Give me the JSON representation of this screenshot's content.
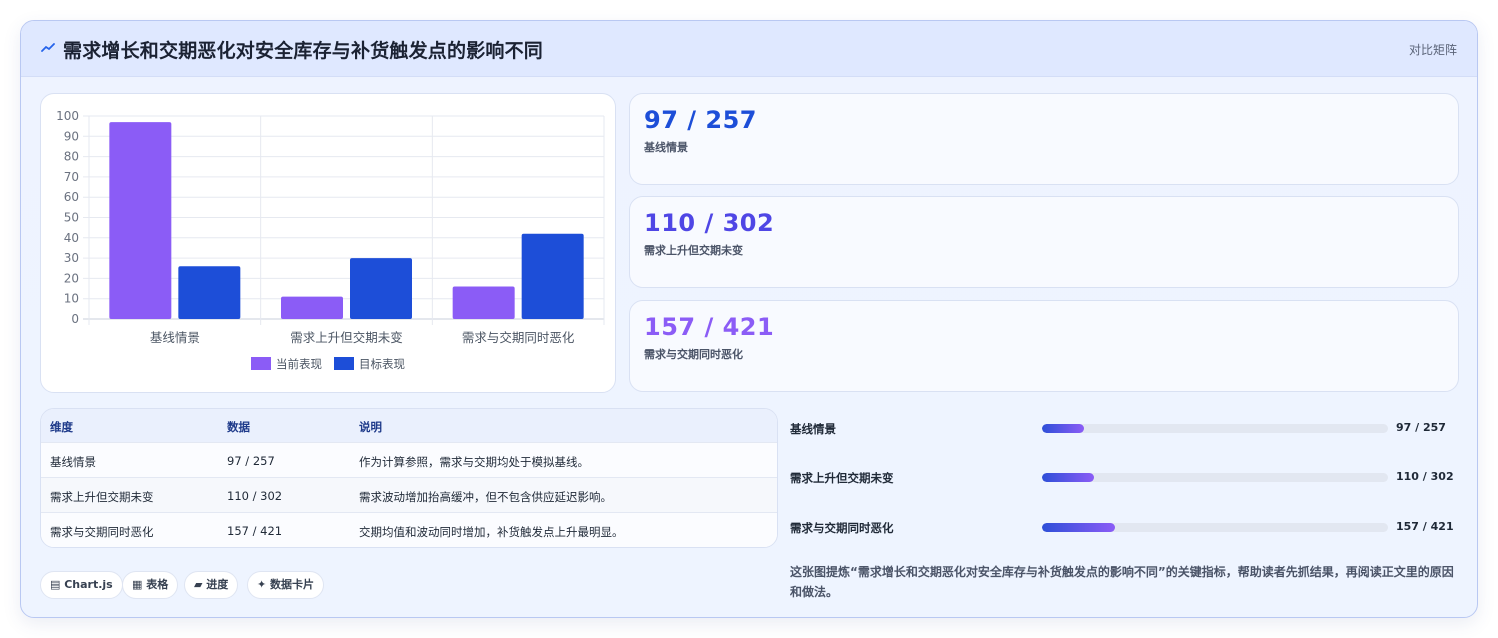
{
  "header": {
    "title": "需求增长和交期恶化对安全库存与补货触发点的影响不同",
    "type_label": "对比矩阵"
  },
  "colors": {
    "current": "#8b5cf6",
    "target": "#1d4ed8",
    "kpi_values": [
      "#1d4ed8",
      "#4f46e5",
      "#8b5cf6"
    ]
  },
  "chart_data": {
    "type": "bar",
    "categories": [
      "基线情景",
      "需求上升但交期未变",
      "需求与交期同时恶化"
    ],
    "series": [
      {
        "name": "当前表现",
        "values": [
          97,
          11,
          16
        ]
      },
      {
        "name": "目标表现",
        "values": [
          26,
          30,
          42
        ]
      }
    ],
    "ylim": [
      0,
      100
    ],
    "yticks": [
      0,
      10,
      20,
      30,
      40,
      50,
      60,
      70,
      80,
      90,
      100
    ],
    "grid": true,
    "legend": "bottom"
  },
  "kpis": [
    {
      "value": "97 / 257",
      "label": "基线情景"
    },
    {
      "value": "110 / 302",
      "label": "需求上升但交期未变"
    },
    {
      "value": "157 / 421",
      "label": "需求与交期同时恶化"
    }
  ],
  "table": {
    "headers": [
      "维度",
      "数据",
      "说明"
    ],
    "rows": [
      [
        "基线情景",
        "97 / 257",
        "作为计算参照，需求与交期均处于模拟基线。"
      ],
      [
        "需求上升但交期未变",
        "110 / 302",
        "需求波动增加抬高缓冲，但不包含供应延迟影响。"
      ],
      [
        "需求与交期同时恶化",
        "157 / 421",
        "交期均值和波动同时增加，补货触发点上升最明显。"
      ]
    ]
  },
  "chips": [
    "▤ Chart.js",
    "▦ 表格",
    "▰ 进度",
    "✦ 数据卡片"
  ],
  "progress": [
    {
      "label": "基线情景",
      "value": "97 / 257",
      "fraction": 0.12
    },
    {
      "label": "需求上升但交期未变",
      "value": "110 / 302",
      "fraction": 0.15
    },
    {
      "label": "需求与交期同时恶化",
      "value": "157 / 421",
      "fraction": 0.21
    }
  ],
  "note": "这张图提炼“需求增长和交期恶化对安全库存与补货触发点的影响不同”的关键指标，帮助读者先抓结果，再阅读正文里的原因和做法。"
}
